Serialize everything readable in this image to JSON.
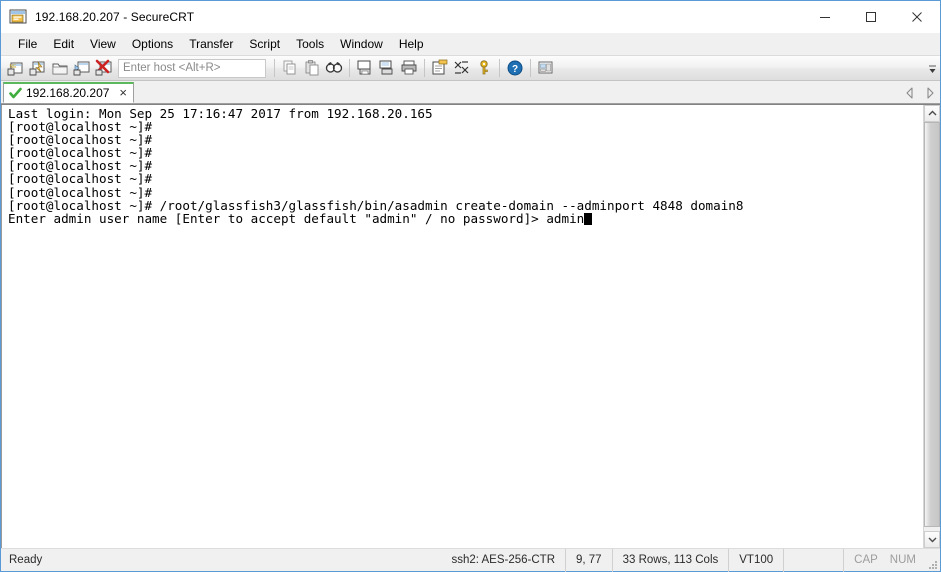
{
  "window": {
    "title": "192.168.20.207 - SecureCRT",
    "app_icon": "securecrt-icon",
    "minimize_label": "Minimize",
    "maximize_label": "Maximize",
    "close_label": "Close"
  },
  "menubar": {
    "items": [
      {
        "label": "File",
        "name": "menu-file"
      },
      {
        "label": "Edit",
        "name": "menu-edit"
      },
      {
        "label": "View",
        "name": "menu-view"
      },
      {
        "label": "Options",
        "name": "menu-options"
      },
      {
        "label": "Transfer",
        "name": "menu-transfer"
      },
      {
        "label": "Script",
        "name": "menu-script"
      },
      {
        "label": "Tools",
        "name": "menu-tools"
      },
      {
        "label": "Window",
        "name": "menu-window"
      },
      {
        "label": "Help",
        "name": "menu-help"
      }
    ]
  },
  "toolbar": {
    "host_input_placeholder": "Enter host <Alt+R>",
    "host_input_value": "",
    "icons": [
      "new-session-icon",
      "quick-connect-icon",
      "open-session-folder-icon",
      "connect-sftp-tab-icon",
      "disconnect-icon",
      "copy-icon",
      "paste-icon",
      "find-icon",
      "print-screen-icon",
      "log-session-icon",
      "print-icon",
      "session-options-icon",
      "toggle-chat-window-icon",
      "key-icon",
      "help-icon",
      "tile-windows-icon"
    ]
  },
  "tabs": {
    "items": [
      {
        "label": "192.168.20.207",
        "connected": true,
        "active": true
      }
    ],
    "close_glyph": "×",
    "prev_label": "Previous tab",
    "next_label": "Next tab"
  },
  "terminal": {
    "lines": [
      "Last login: Mon Sep 25 17:16:47 2017 from 192.168.20.165",
      "[root@localhost ~]#",
      "[root@localhost ~]#",
      "[root@localhost ~]#",
      "[root@localhost ~]#",
      "[root@localhost ~]#",
      "[root@localhost ~]#",
      "[root@localhost ~]# /root/glassfish3/glassfish/bin/asadmin create-domain --adminport 4848 domain8"
    ],
    "prompt_line": "Enter admin user name [Enter to accept default \"admin\" / no password]> admin",
    "cursor": "block",
    "fg_color": "#000000",
    "bg_color": "#ffffff"
  },
  "statusbar": {
    "status": "Ready",
    "protocol": "ssh2: AES-256-CTR",
    "position": "9, 77",
    "dimensions": "33 Rows, 113 Cols",
    "emulation": "VT100",
    "caps": "CAP",
    "num": "NUM"
  },
  "colors": {
    "accent": "#5b9bd5",
    "tab_connected": "#5cb85c",
    "chrome": "#f0f0f0",
    "terminal_bg": "#ffffff"
  }
}
